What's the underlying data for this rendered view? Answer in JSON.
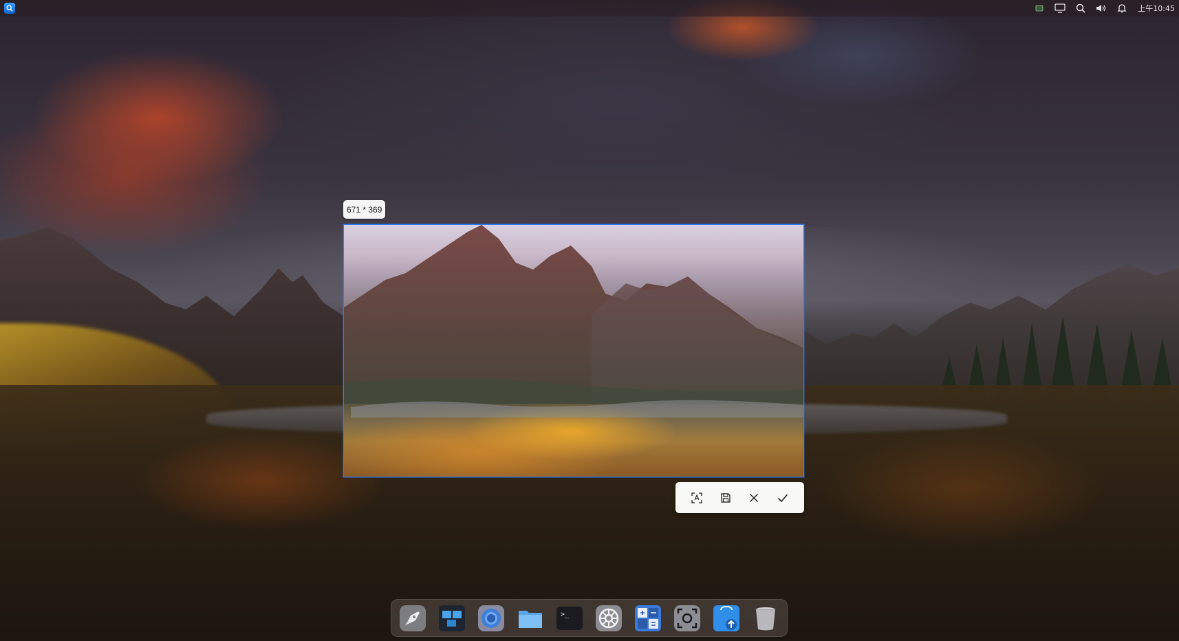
{
  "top_panel": {
    "launcher": {
      "icon": "launcher-icon"
    },
    "tray": [
      {
        "name": "input-method-icon"
      },
      {
        "name": "display-icon"
      },
      {
        "name": "search-icon"
      },
      {
        "name": "volume-icon"
      },
      {
        "name": "notification-bell-icon"
      }
    ],
    "clock": "上午10:45"
  },
  "screenshot": {
    "size_label": "671 * 369",
    "selection_border_color": "#2a7bff",
    "toolbar": [
      {
        "name": "ocr-button",
        "icon": "ocr-scan-icon"
      },
      {
        "name": "save-button",
        "icon": "save-icon"
      },
      {
        "name": "cancel-button",
        "icon": "close-icon"
      },
      {
        "name": "confirm-button",
        "icon": "check-icon"
      }
    ]
  },
  "dock": {
    "items": [
      {
        "name": "launcher",
        "icon": "rocket-icon"
      },
      {
        "name": "multitasking-view",
        "icon": "multitask-icon"
      },
      {
        "name": "browser",
        "icon": "browser-icon"
      },
      {
        "name": "file-manager",
        "icon": "folder-icon"
      },
      {
        "name": "terminal",
        "icon": "terminal-icon"
      },
      {
        "name": "control-center",
        "icon": "settings-gear-icon"
      },
      {
        "name": "calculator",
        "icon": "calculator-icon"
      },
      {
        "name": "screen-capture",
        "icon": "camera-icon"
      },
      {
        "name": "app-store",
        "icon": "app-store-icon"
      },
      {
        "name": "trash",
        "icon": "trash-icon"
      }
    ],
    "terminal_prompt": ">_"
  },
  "colors": {
    "accent": "#2a7bff",
    "panel_bg": "rgba(40,30,35,0.55)",
    "toolbar_bg": "#ffffff"
  }
}
